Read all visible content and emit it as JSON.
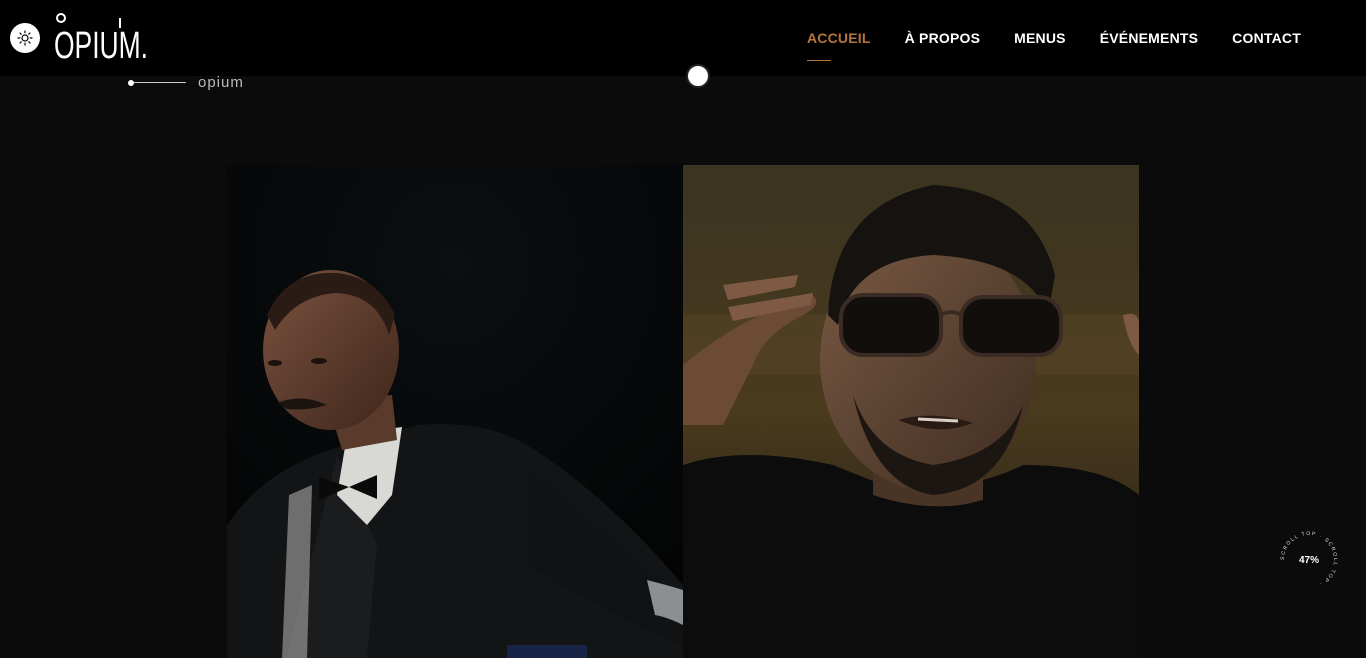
{
  "header": {
    "logo_text": "OPIUM.",
    "theme_toggle_icon": "sun-icon",
    "nav": [
      {
        "label": "ACCUEIL",
        "active": true
      },
      {
        "label": "À PROPOS",
        "active": false
      },
      {
        "label": "MENUS",
        "active": false
      },
      {
        "label": "ÉVÉNEMENTS",
        "active": false
      },
      {
        "label": "CONTACT",
        "active": false
      }
    ]
  },
  "section": {
    "label": "opium"
  },
  "scroll_top": {
    "ring_text": "SCROLL TOP · SCROLL TOP · ",
    "percent": "47%"
  },
  "colors": {
    "accent": "#b5773f",
    "header_bg": "#000000",
    "page_bg": "#0b0b0b"
  }
}
